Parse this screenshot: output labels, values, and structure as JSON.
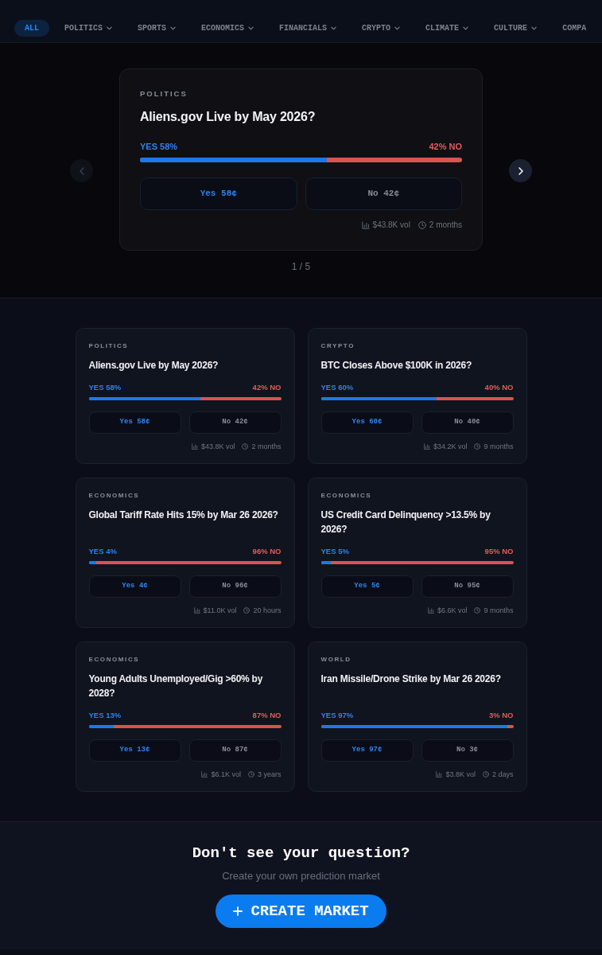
{
  "nav": {
    "tabs": [
      {
        "label": "ALL",
        "selected": true,
        "dropdown": false
      },
      {
        "label": "POLITICS",
        "selected": false,
        "dropdown": true
      },
      {
        "label": "SPORTS",
        "selected": false,
        "dropdown": true
      },
      {
        "label": "ECONOMICS",
        "selected": false,
        "dropdown": true
      },
      {
        "label": "FINANCIALS",
        "selected": false,
        "dropdown": true
      },
      {
        "label": "CRYPTO",
        "selected": false,
        "dropdown": true
      },
      {
        "label": "CLIMATE",
        "selected": false,
        "dropdown": true
      },
      {
        "label": "CULTURE",
        "selected": false,
        "dropdown": true
      },
      {
        "label": "COMPA",
        "selected": false,
        "dropdown": false
      }
    ]
  },
  "featured": {
    "prev_button": {
      "disabled": true
    },
    "next_button": {
      "disabled": false
    },
    "market": {
      "category": "POLITICS",
      "question": "Aliens.gov Live by May 2026?",
      "yes_label": "YES 58%",
      "no_label": "42% NO",
      "level": 0.58,
      "yes_button": "Yes 58¢",
      "no_button": "No 42¢",
      "volume": "$43.8K vol",
      "time_left": "2 months"
    },
    "pager": "1 / 5"
  },
  "markets": [
    {
      "category": "POLITICS",
      "question": "Aliens.gov Live by May 2026?",
      "yes_label": "YES 58%",
      "no_label": "42% NO",
      "level": 0.58,
      "yes_button": "Yes 58¢",
      "no_button": "No 42¢",
      "volume": "$43.8K vol",
      "time_left": "2 months"
    },
    {
      "category": "CRYPTO",
      "question": "BTC Closes Above $100K in 2026?",
      "yes_label": "YES 60%",
      "no_label": "40% NO",
      "level": 0.6,
      "yes_button": "Yes 60¢",
      "no_button": "No 40¢",
      "volume": "$34.2K vol",
      "time_left": "9 months"
    },
    {
      "category": "ECONOMICS",
      "question": "Global Tariff Rate Hits 15% by Mar 26 2026?",
      "yes_label": "YES 4%",
      "no_label": "96% NO",
      "level": 0.04,
      "yes_button": "Yes 4¢",
      "no_button": "No 96¢",
      "volume": "$11.0K vol",
      "time_left": "20 hours"
    },
    {
      "category": "ECONOMICS",
      "question": "US Credit Card Delinquency >13.5% by 2026?",
      "yes_label": "YES 5%",
      "no_label": "95% NO",
      "level": 0.05,
      "yes_button": "Yes 5¢",
      "no_button": "No 95¢",
      "volume": "$6.6K vol",
      "time_left": "9 months"
    },
    {
      "category": "ECONOMICS",
      "question": "Young Adults Unemployed/Gig >60% by 2028?",
      "yes_label": "YES 13%",
      "no_label": "87% NO",
      "level": 0.13,
      "yes_button": "Yes 13¢",
      "no_button": "No 87¢",
      "volume": "$6.1K vol",
      "time_left": "3 years"
    },
    {
      "category": "WORLD",
      "question": "Iran Missile/Drone Strike by Mar 26 2026?",
      "yes_label": "YES 97%",
      "no_label": "3% NO",
      "level": 0.97,
      "yes_button": "Yes 97¢",
      "no_button": "No 3¢",
      "volume": "$3.8K vol",
      "time_left": "2 days"
    }
  ],
  "cta": {
    "heading": "Don't see your question?",
    "subtitle": "Create your own prediction market",
    "button": "CREATE MARKET"
  }
}
